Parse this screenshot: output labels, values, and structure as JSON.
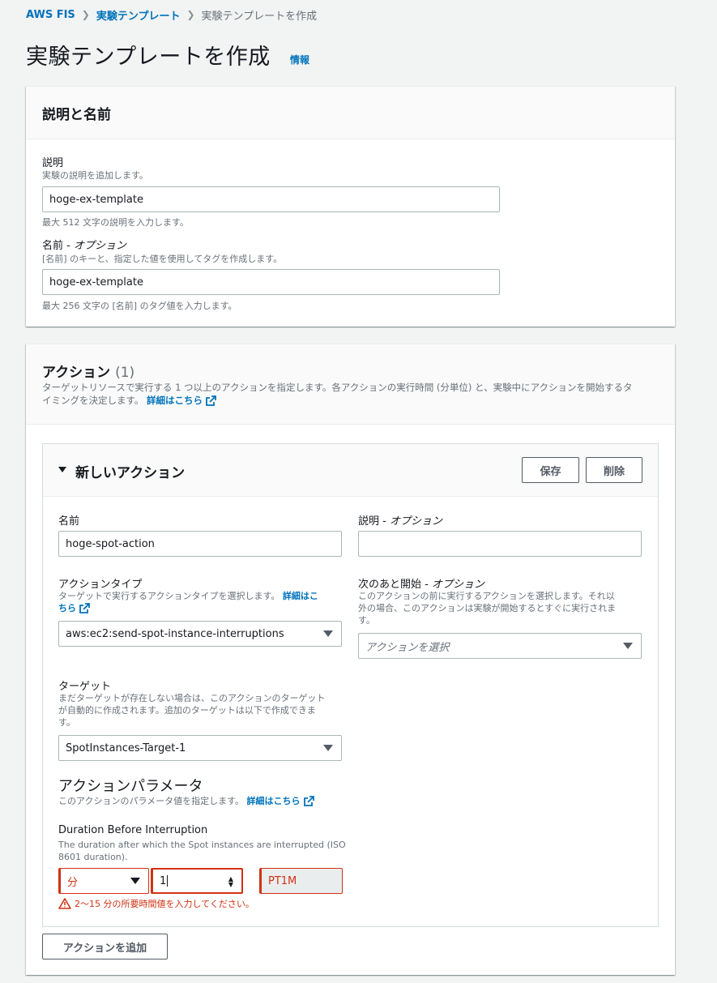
{
  "breadcrumb": {
    "root": "AWS FIS",
    "parent": "実験テンプレート",
    "current": "実験テンプレートを作成"
  },
  "page": {
    "title": "実験テンプレートを作成",
    "info": "情報"
  },
  "description_panel": {
    "title": "説明と名前",
    "description_label": "説明",
    "description_help": "実験の説明を追加します。",
    "description_value": "hoge-ex-template",
    "description_constraint": "最大 512 文字の説明を入力します。",
    "name_label": "名前 - ",
    "name_label_optional": "オプション",
    "name_help": "[名前] のキーと、指定した値を使用してタグを作成します。",
    "name_value": "hoge-ex-template",
    "name_constraint": "最大 256 文字の [名前] のタグ値を入力します。"
  },
  "actions_panel": {
    "title": "アクション",
    "count": "(1)",
    "help_line1": "ターゲットリソースで実行する 1 つ以上のアクションを指定します。各アクションの実行時間 (分単位) と、実験中にアクションを開始するタ",
    "help_line2": "イミングを決定します。",
    "learn_more": "詳細はこちら",
    "add_action": "アクションを追加"
  },
  "new_action": {
    "title": "新しいアクション",
    "save": "保存",
    "delete": "削除",
    "name_label": "名前",
    "name_value": "hoge-spot-action",
    "desc_label": "説明 - ",
    "desc_label_optional": "オプション",
    "desc_value": "",
    "type_label": "アクションタイプ",
    "type_help": "ターゲットで実行するアクションタイプを選択します。",
    "type_learn_more_1": "詳細はこ",
    "type_learn_more_2": "ちら",
    "type_value": "aws:ec2:send-spot-instance-interruptions",
    "start_after_label": "次のあと開始 - ",
    "start_after_optional": "オプション",
    "start_after_help_1": "このアクションの前に実行するアクションを選択します。それ以",
    "start_after_help_2": "外の場合、このアクションは実験が開始するとすぐに実行されま",
    "start_after_help_3": "す。",
    "start_after_placeholder": "アクションを選択",
    "target_label": "ターゲット",
    "target_help_1": "まだターゲットが存在しない場合は、このアクションのターゲット",
    "target_help_2": "が自動的に作成されます。追加のターゲットは以下で作成できま",
    "target_help_3": "す。",
    "target_value": "SpotInstances-Target-1",
    "params_title": "アクションパラメータ",
    "params_help": "このアクションのパラメータ値を指定します。",
    "params_learn_more": "詳細はこちら",
    "duration_label": "Duration Before Interruption",
    "duration_help_1": "The duration after which the Spot instances are interrupted (ISO",
    "duration_help_2": "8601 duration).",
    "duration_unit": "分",
    "duration_value": "1",
    "duration_iso": "PT1M",
    "duration_error": "2～15 分の所要時間値を入力してください。"
  }
}
